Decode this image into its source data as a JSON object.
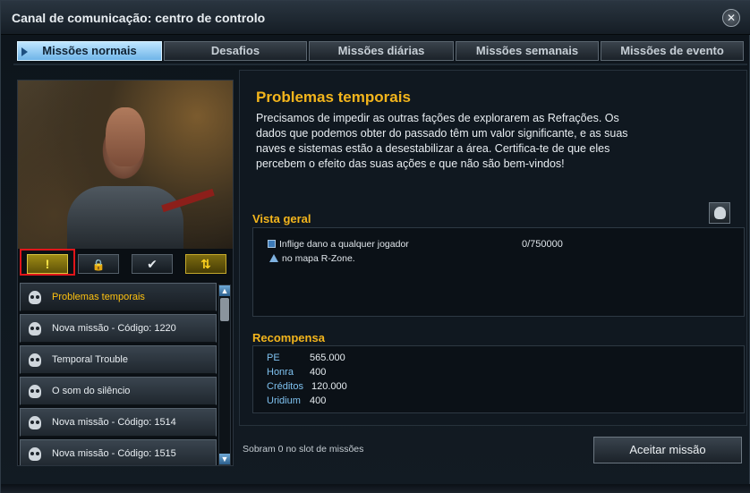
{
  "window": {
    "title": "Canal de comunicação: centro de controlo"
  },
  "tabs": [
    {
      "label": "Missões normais",
      "active": true
    },
    {
      "label": "Desafios",
      "active": false
    },
    {
      "label": "Missões diárias",
      "active": false
    },
    {
      "label": "Missões semanais",
      "active": false
    },
    {
      "label": "Missões de evento",
      "active": false
    }
  ],
  "filters": {
    "warn_glyph": "!",
    "lock_glyph": "🔒",
    "check_glyph": "✔",
    "updown_glyph": "⇅"
  },
  "missions": [
    {
      "label": "Problemas temporais",
      "active": true
    },
    {
      "label": "Nova missão - Código: 1220",
      "active": false
    },
    {
      "label": "Temporal Trouble",
      "active": false
    },
    {
      "label": "O som do silêncio",
      "active": false
    },
    {
      "label": "Nova missão - Código: 1514",
      "active": false
    },
    {
      "label": "Nova missão - Código: 1515",
      "active": false
    }
  ],
  "detail": {
    "title": "Problemas temporais",
    "description": "Precisamos de impedir as outras fações de explorarem as Refrações. Os dados que podemos obter do passado têm um valor significante, e as suas naves e sistemas estão a desestabilizar a área. Certifica-te de que eles percebem o efeito das suas ações e que não são bem-vindos!",
    "overview_title": "Vista geral",
    "tasks": [
      {
        "text": "Inflige dano a qualquer jogador",
        "progress": "0/750000",
        "icon": "task-box-icon"
      },
      {
        "text": "no mapa R-Zone.",
        "icon": "warning-icon"
      }
    ],
    "reward_title": "Recompensa",
    "rewards": [
      {
        "key": "PE",
        "value": "565.000"
      },
      {
        "key": "Honra",
        "value": "400"
      },
      {
        "key": "Créditos",
        "value": "120.000"
      },
      {
        "key": "Uridium",
        "value": "400"
      }
    ]
  },
  "footer": {
    "slots_text": "Sobram  0 no slot de missões",
    "accept_label": "Aceitar missão"
  },
  "colors": {
    "accent": "#f3b51c",
    "active_tab": "#8fcaf2",
    "highlight": "#e0151a"
  }
}
